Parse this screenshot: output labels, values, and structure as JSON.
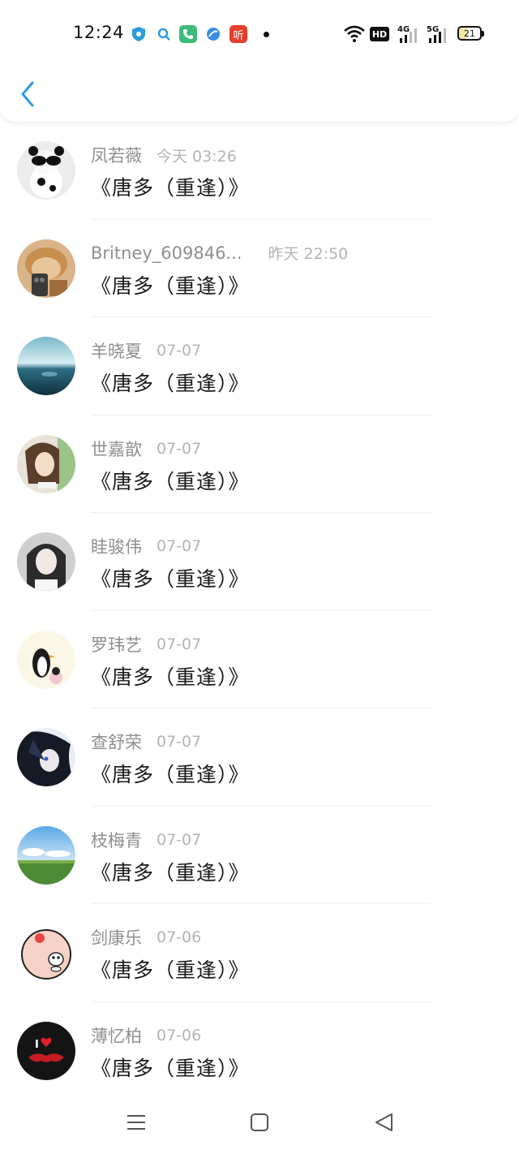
{
  "status_bar": {
    "time": "12:24",
    "notification_icons": [
      "shield-app-icon",
      "search-app-icon",
      "phone-app-icon",
      "browser-app-icon",
      "listen-app-icon"
    ],
    "notification_badge_text": "听",
    "network_hd": "HD",
    "network_4g": "4G",
    "network_5g": "5G",
    "battery_level": "21"
  },
  "header": {
    "back_icon": "chevron-left-icon"
  },
  "colors": {
    "accent": "#2d9cdb",
    "name_text": "#8f8f8f",
    "time_text": "#b4b4b4",
    "title_text": "#1a1a1a"
  },
  "items": [
    {
      "name": "凤若薇",
      "time": "今天 03:26",
      "title": "《唐多（重逢）》",
      "avatar": "panda-glasses-avatar"
    },
    {
      "name": "Britney_609846...",
      "time": "昨天 22:50",
      "title": "《唐多（重逢）》",
      "avatar": "dog-phone-avatar"
    },
    {
      "name": "羊晓夏",
      "time": "07-07",
      "title": "《唐多（重逢）》",
      "avatar": "sea-horizon-avatar"
    },
    {
      "name": "世嘉歆",
      "time": "07-07",
      "title": "《唐多（重逢）》",
      "avatar": "girl-portrait-avatar"
    },
    {
      "name": "眭骏伟",
      "time": "07-07",
      "title": "《唐多（重逢）》",
      "avatar": "girl-bw-avatar"
    },
    {
      "name": "罗玮艺",
      "time": "07-07",
      "title": "《唐多（重逢）》",
      "avatar": "penguin-avatar"
    },
    {
      "name": "查舒荣",
      "time": "07-07",
      "title": "《唐多（重逢）》",
      "avatar": "anime-character-avatar"
    },
    {
      "name": "枝梅青",
      "time": "07-07",
      "title": "《唐多（重逢）》",
      "avatar": "grassland-sky-avatar"
    },
    {
      "name": "剑康乐",
      "time": "07-06",
      "title": "《唐多（重逢）》",
      "avatar": "cartoon-pig-avatar"
    },
    {
      "name": "薄忆柏",
      "time": "07-06",
      "title": "《唐多（重逢）》",
      "avatar": "i-love-mustache-avatar"
    }
  ],
  "avatar_9_text": "I",
  "nav_bar": {
    "menu_icon": "menu-lines-icon",
    "home_icon": "home-square-icon",
    "back_icon": "back-triangle-icon"
  }
}
